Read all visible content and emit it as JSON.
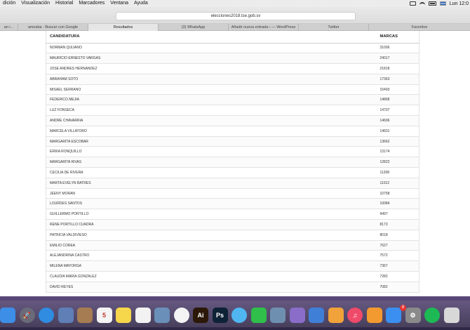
{
  "menubar": {
    "items": [
      "dición",
      "Visualización",
      "Historial",
      "Marcadores",
      "Ventana",
      "Ayuda"
    ],
    "clock": "Lun 12:0"
  },
  "browser": {
    "address": "elecciones2018.tse.gob.sv",
    "tabs": [
      {
        "label": "an i..."
      },
      {
        "label": "amosba - Buscar con Google"
      },
      {
        "label": "Resultados"
      },
      {
        "label": "(3) WhatsApp"
      },
      {
        "label": "Añadir nueva entrada ‹ — WordPress"
      },
      {
        "label": "Twitter"
      },
      {
        "label": "Favoritos"
      }
    ]
  },
  "table": {
    "headers": {
      "candidate": "CANDIDATURA",
      "marks": "MARCAS"
    },
    "rows": [
      {
        "name": "NORMAN QUIJANO",
        "marks": "31006"
      },
      {
        "name": "MAURICIO ERNESTO VARGAS",
        "marks": "24017"
      },
      {
        "name": "JOSE ANDRES HERNANDEZ",
        "marks": "21818"
      },
      {
        "name": "ABRAHAM SOTO",
        "marks": "17363"
      },
      {
        "name": "MISAEL SERRANO",
        "marks": "15493"
      },
      {
        "name": "FEDERICO MEJIA",
        "marks": "14868"
      },
      {
        "name": "LUZ FONSECA",
        "marks": "14707"
      },
      {
        "name": "ANDRE CHAVARRIA",
        "marks": "14696"
      },
      {
        "name": "MARCELA VILLATORO",
        "marks": "14601"
      },
      {
        "name": "MARGARITA ESCOBAR",
        "marks": "13662"
      },
      {
        "name": "ERIKA RONQUILLO",
        "marks": "13174"
      },
      {
        "name": "MARGARITA RIVAS",
        "marks": "12822"
      },
      {
        "name": "CECILIA DE RIVERA",
        "marks": "11208"
      },
      {
        "name": "MARTA EVELYN BATRES",
        "marks": "11012"
      },
      {
        "name": "JEENY MORAN",
        "marks": "10758"
      },
      {
        "name": "LOURDES SANTOS",
        "marks": "10084"
      },
      {
        "name": "GUILLERMO PORTILLO",
        "marks": "9497"
      },
      {
        "name": "RENE PORTILLO CUADRA",
        "marks": "8173"
      },
      {
        "name": "PATRICIA VALDIVIESO",
        "marks": "8018"
      },
      {
        "name": "EMILIO COREA",
        "marks": "7627"
      },
      {
        "name": "ALEJANDRINA CASTRO",
        "marks": "7572"
      },
      {
        "name": "MILENA MAYORGA",
        "marks": "7367"
      },
      {
        "name": "CLAUDIA MARIA GONZALEZ",
        "marks": "7282"
      },
      {
        "name": "DAVID REYES",
        "marks": "7082"
      }
    ]
  },
  "dock": {
    "icons": [
      {
        "name": "finder-icon",
        "glyph": "",
        "color": "#3d8ee6",
        "round": false
      },
      {
        "name": "launchpad-icon",
        "glyph": "🚀",
        "color": "#6a6a78",
        "round": true
      },
      {
        "name": "safari-icon",
        "glyph": "",
        "color": "#2f8ce0",
        "round": true
      },
      {
        "name": "mail-stamp-icon",
        "glyph": "",
        "color": "#5f7fb6",
        "round": false
      },
      {
        "name": "contacts-icon",
        "glyph": "",
        "color": "#a67c52",
        "round": false
      },
      {
        "name": "calendar-icon",
        "glyph": "5",
        "color": "#f4f4f4",
        "round": false
      },
      {
        "name": "notes-icon",
        "glyph": "",
        "color": "#f6d64a",
        "round": false
      },
      {
        "name": "reminders-icon",
        "glyph": "",
        "color": "#f2f2f2",
        "round": false
      },
      {
        "name": "photo-booth-icon",
        "glyph": "",
        "color": "#6a8fb8",
        "round": false
      },
      {
        "name": "photos-icon",
        "glyph": "",
        "color": "#f3f3f3",
        "round": true
      },
      {
        "name": "illustrator-icon",
        "glyph": "Ai",
        "color": "#2b1808",
        "round": false
      },
      {
        "name": "photoshop-icon",
        "glyph": "Ps",
        "color": "#0e2236",
        "round": false
      },
      {
        "name": "messages-icon",
        "glyph": "",
        "color": "#4fb6f2",
        "round": true
      },
      {
        "name": "facetime-icon",
        "glyph": "",
        "color": "#2fbf4a",
        "round": false
      },
      {
        "name": "preview-icon",
        "glyph": "",
        "color": "#6f8fb0",
        "round": false
      },
      {
        "name": "script-icon",
        "glyph": "",
        "color": "#8a6cc9",
        "round": false
      },
      {
        "name": "keynote-icon",
        "glyph": "",
        "color": "#3f7fd8",
        "round": false
      },
      {
        "name": "pages-icon",
        "glyph": "",
        "color": "#f2a23a",
        "round": false
      },
      {
        "name": "music-icon",
        "glyph": "♫",
        "color": "#f04a6a",
        "round": true
      },
      {
        "name": "books-icon",
        "glyph": "",
        "color": "#f29a2f",
        "round": false
      },
      {
        "name": "app-store-icon",
        "glyph": "",
        "color": "#3a8ff0",
        "round": false
      },
      {
        "name": "system-preferences-icon",
        "glyph": "⚙",
        "color": "#8a8a8a",
        "round": false
      },
      {
        "name": "spotify-icon",
        "glyph": "",
        "color": "#1db954",
        "round": true
      },
      {
        "name": "downloads-icon",
        "glyph": "",
        "color": "#d8d8d8",
        "round": false
      }
    ],
    "badge": "8"
  }
}
